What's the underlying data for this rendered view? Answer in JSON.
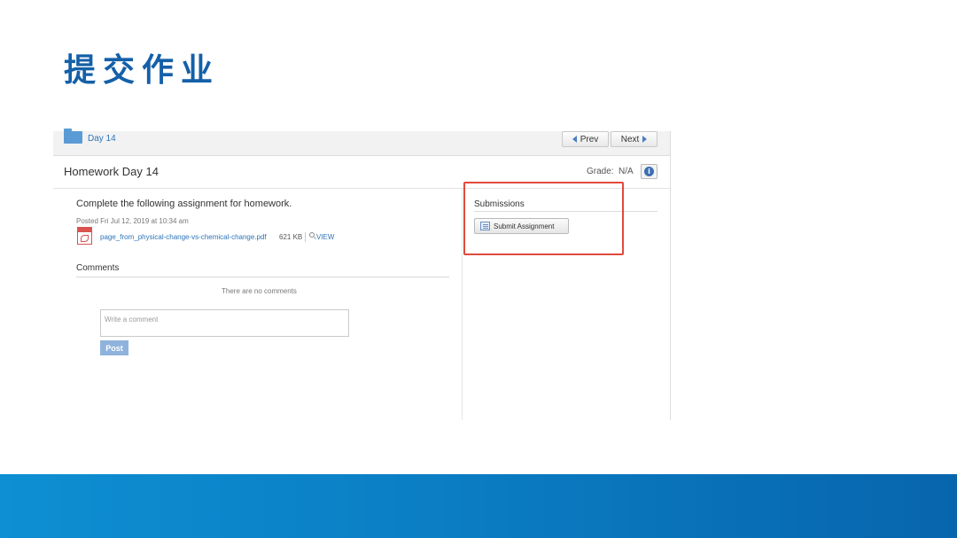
{
  "slide": {
    "title": "提交作业"
  },
  "topbar": {
    "breadcrumb": "Day 14",
    "prev_label": "Prev",
    "next_label": "Next"
  },
  "assignment": {
    "title": "Homework Day 14",
    "grade_label": "Grade:",
    "grade_value": "N/A",
    "instructions": "Complete the following assignment for homework.",
    "posted": "Posted Fri Jul 12, 2019 at 10:34 am",
    "file_name": "page_from_physical-change-vs-chemical-change.pdf",
    "file_size": "621 KB",
    "view_label": "VIEW"
  },
  "comments": {
    "heading": "Comments",
    "empty_text": "There are no comments",
    "placeholder": "Write a comment",
    "post_label": "Post"
  },
  "submissions": {
    "heading": "Submissions",
    "submit_label": "Submit Assignment"
  },
  "colors": {
    "title_blue": "#1560a8",
    "link_blue": "#2d74b8",
    "highlight_red": "#e04a3c",
    "footer_blue": "#0b7ec4"
  }
}
